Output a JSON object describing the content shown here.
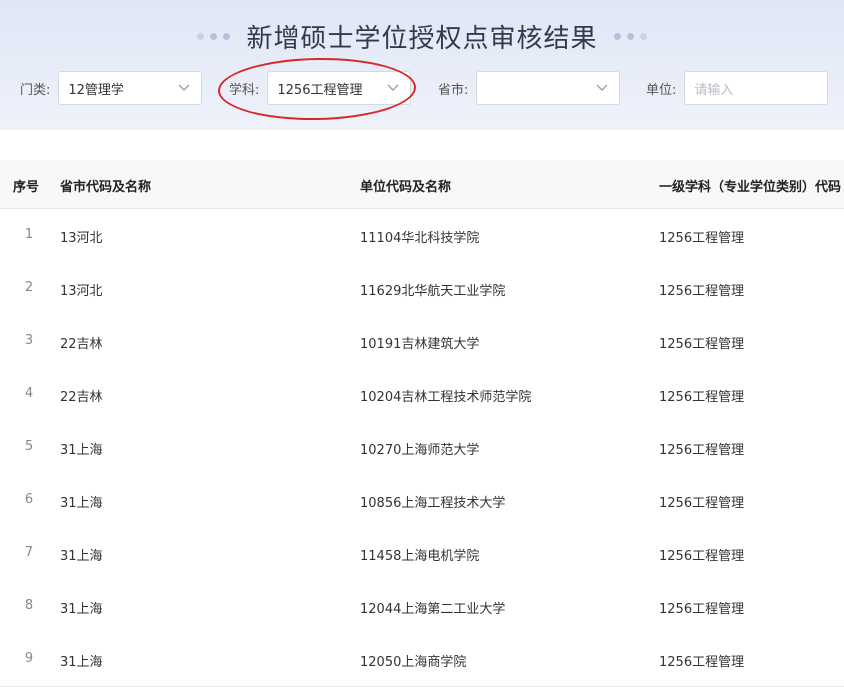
{
  "page": {
    "title": "新增硕士学位授权点审核结果",
    "accent_dot_color": "#b6c1e0",
    "annotation_color": "#d6282b"
  },
  "filters": {
    "category": {
      "label": "门类:",
      "value": "12管理学",
      "icon": "chevron-down-icon"
    },
    "discipline": {
      "label": "学科:",
      "value": "1256工程管理",
      "icon": "chevron-down-icon"
    },
    "province": {
      "label": "省市:",
      "value": "",
      "icon": "chevron-down-icon"
    },
    "unit": {
      "label": "单位:",
      "placeholder": "请输入"
    }
  },
  "table": {
    "headers": [
      "序号",
      "省市代码及名称",
      "单位代码及名称",
      "一级学科（专业学位类别）代码"
    ],
    "rows": [
      {
        "idx": "1",
        "province": "13河北",
        "unit": "11104华北科技学院",
        "discipline": "1256工程管理"
      },
      {
        "idx": "2",
        "province": "13河北",
        "unit": "11629北华航天工业学院",
        "discipline": "1256工程管理"
      },
      {
        "idx": "3",
        "province": "22吉林",
        "unit": "10191吉林建筑大学",
        "discipline": "1256工程管理"
      },
      {
        "idx": "4",
        "province": "22吉林",
        "unit": "10204吉林工程技术师范学院",
        "discipline": "1256工程管理"
      },
      {
        "idx": "5",
        "province": "31上海",
        "unit": "10270上海师范大学",
        "discipline": "1256工程管理"
      },
      {
        "idx": "6",
        "province": "31上海",
        "unit": "10856上海工程技术大学",
        "discipline": "1256工程管理"
      },
      {
        "idx": "7",
        "province": "31上海",
        "unit": "11458上海电机学院",
        "discipline": "1256工程管理"
      },
      {
        "idx": "8",
        "province": "31上海",
        "unit": "12044上海第二工业大学",
        "discipline": "1256工程管理"
      },
      {
        "idx": "9",
        "province": "31上海",
        "unit": "12050上海商学院",
        "discipline": "1256工程管理"
      }
    ]
  }
}
